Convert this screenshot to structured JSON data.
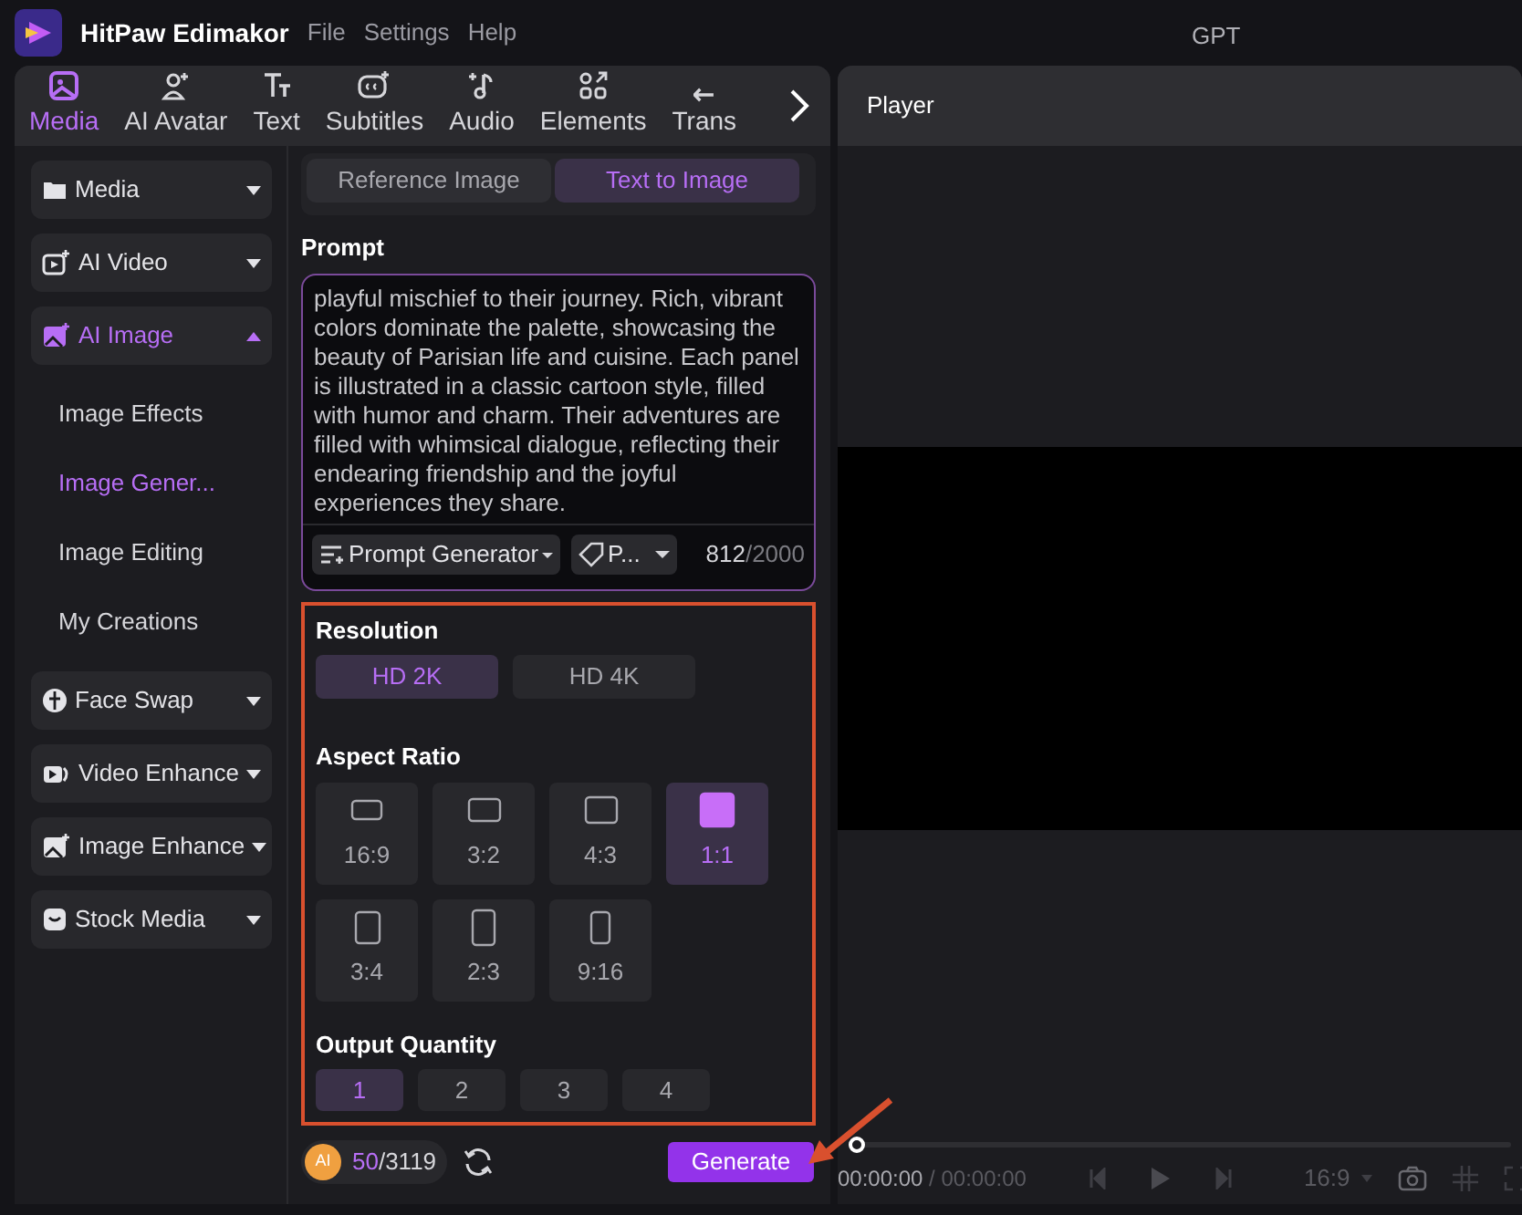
{
  "app": {
    "name": "HitPaw Edimakor",
    "menu": [
      "File",
      "Settings",
      "Help"
    ]
  },
  "window_title": "GPT",
  "toolbar_tabs": [
    {
      "label": "Media",
      "selected": true
    },
    {
      "label": "AI Avatar",
      "selected": false
    },
    {
      "label": "Text",
      "selected": false
    },
    {
      "label": "Subtitles",
      "selected": false
    },
    {
      "label": "Audio",
      "selected": false
    },
    {
      "label": "Elements",
      "selected": false
    },
    {
      "label": "Trans",
      "selected": false
    }
  ],
  "sidebar": {
    "items": [
      {
        "label": "Media",
        "expanded": false,
        "selected": false
      },
      {
        "label": "AI Video",
        "expanded": false,
        "selected": false
      },
      {
        "label": "AI Image",
        "expanded": true,
        "selected": true,
        "children": [
          {
            "label": "Image Effects",
            "selected": false
          },
          {
            "label": "Image Gener...",
            "selected": true
          },
          {
            "label": "Image Editing",
            "selected": false
          },
          {
            "label": "My Creations",
            "selected": false
          }
        ]
      },
      {
        "label": "Face Swap",
        "expanded": false,
        "selected": false
      },
      {
        "label": "Video Enhance",
        "expanded": false,
        "selected": false
      },
      {
        "label": "Image Enhance",
        "expanded": false,
        "selected": false
      },
      {
        "label": "Stock Media",
        "expanded": false,
        "selected": false
      }
    ]
  },
  "mode_tabs": [
    {
      "label": "Reference Image",
      "selected": false
    },
    {
      "label": "Text to Image",
      "selected": true
    }
  ],
  "prompt": {
    "label": "Prompt",
    "value": "playful mischief to their journey. Rich, vibrant colors dominate the palette, showcasing the beauty of Parisian life and cuisine. Each panel is illustrated in a classic cartoon style, filled with humor and charm. Their adventures are filled with whimsical dialogue, reflecting their endearing friendship and the joyful experiences they share.",
    "generator_button": "Prompt Generator",
    "style_button": "P...",
    "count": "812",
    "limit": "/2000"
  },
  "resolution": {
    "label": "Resolution",
    "options": [
      {
        "label": "HD 2K",
        "selected": true
      },
      {
        "label": "HD 4K",
        "selected": false
      }
    ]
  },
  "aspect_ratio": {
    "label": "Aspect Ratio",
    "options": [
      {
        "label": "16:9",
        "kind": "wide",
        "selected": false
      },
      {
        "label": "3:2",
        "kind": "landscape",
        "selected": false
      },
      {
        "label": "4:3",
        "kind": "standard",
        "selected": false
      },
      {
        "label": "1:1",
        "kind": "square",
        "selected": true
      },
      {
        "label": "3:4",
        "kind": "portrait",
        "selected": false
      },
      {
        "label": "2:3",
        "kind": "tall",
        "selected": false
      },
      {
        "label": "9:16",
        "kind": "narrow",
        "selected": false
      }
    ]
  },
  "output_quantity": {
    "label": "Output Quantity",
    "options": [
      {
        "label": "1",
        "selected": true
      },
      {
        "label": "2",
        "selected": false
      },
      {
        "label": "3",
        "selected": false
      },
      {
        "label": "4",
        "selected": false
      }
    ]
  },
  "credits": {
    "badge": "AI",
    "used": "50",
    "total": "/3119"
  },
  "generate_button": "Generate",
  "player": {
    "title": "Player",
    "level": 0,
    "time_current": "00:00:00",
    "time_total": "/ 00:00:00",
    "ratio": "16:9"
  }
}
